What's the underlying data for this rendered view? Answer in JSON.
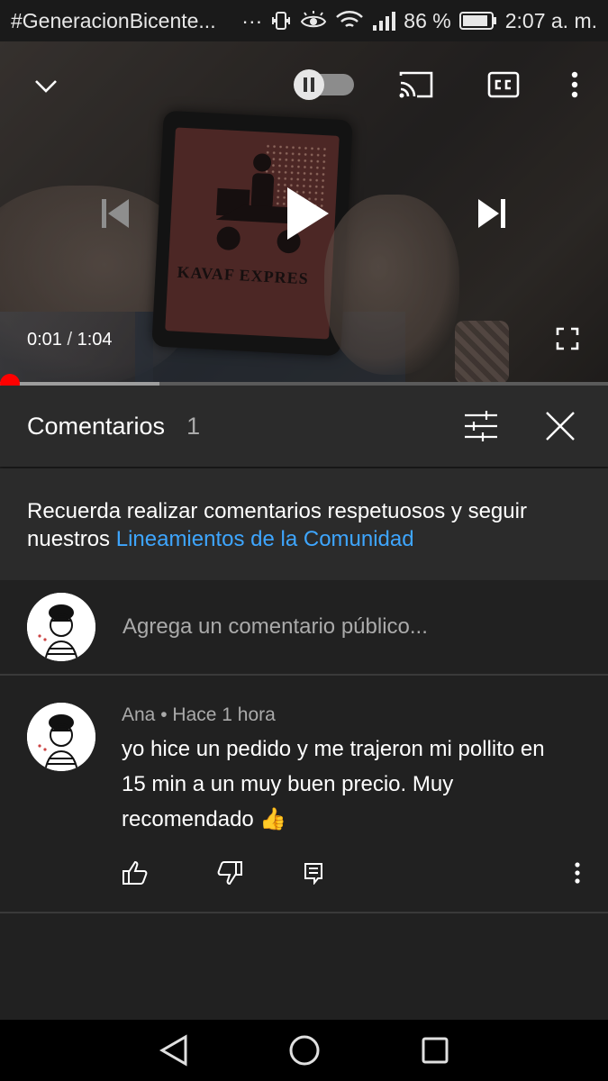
{
  "status_bar": {
    "notification_title": "#GeneracionBicente...",
    "dots": "···",
    "battery_percent": "86 %",
    "time": "2:07 a. m.",
    "icons": [
      "vibrate-icon",
      "eye-icon",
      "wifi-icon",
      "signal-icon",
      "battery-icon"
    ]
  },
  "player": {
    "current_time": "0:01",
    "separator": " / ",
    "duration": "1:04",
    "progress_fraction": 0.0156,
    "buffered_fraction": 0.262,
    "autoplay": true,
    "tablet_text": "KAVAF EXPRES",
    "icons": [
      "chevron-down-icon",
      "autoplay-toggle-icon",
      "cast-icon",
      "captions-icon",
      "more-vert-icon",
      "previous-icon",
      "play-icon",
      "next-icon",
      "fullscreen-icon"
    ]
  },
  "comments_panel": {
    "title": "Comentarios",
    "count": "1",
    "guidelines_text": "Recuerda realizar comentarios respetuosos y seguir nuestros ",
    "guidelines_link": "Lineamientos de la Comunidad",
    "add_comment_placeholder": "Agrega un comentario público..."
  },
  "comments": [
    {
      "author": "Ana",
      "meta_sep": " • ",
      "time": "Hace 1 hora",
      "text": "yo hice un pedido y me trajeron mi pollito en 15 min a un muy buen precio. Muy recomendado 👍"
    }
  ],
  "colors": {
    "background": "#212121",
    "panel": "#2b2b2b",
    "link": "#3ea6ff",
    "progress_played": "#ff0000",
    "secondary_text": "#aaaaaa"
  },
  "nav_icons": [
    "back-icon",
    "home-icon",
    "recents-icon"
  ]
}
